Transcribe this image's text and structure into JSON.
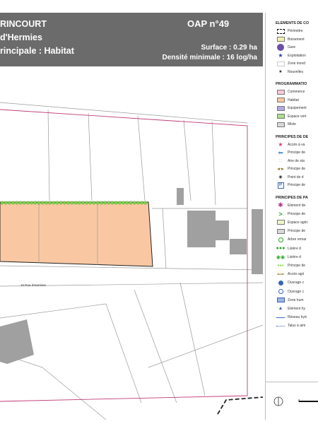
{
  "header": {
    "title_line1": "RINCOURT",
    "title_line2": "d'Hermies",
    "title_line3": "rincipale : Habitat",
    "oap": "OAP n°49",
    "surface": "Surface : 0.29 ha",
    "density": "Densité minimale : 16 log/ha"
  },
  "map": {
    "street_label": "15  Rue d'Hermies",
    "colors": {
      "habitat": "#f9c8a3",
      "green_line": "#7cd44a",
      "perimeter": "#c03a78",
      "building": "#a0a0a0"
    }
  },
  "legend": {
    "sections": [
      {
        "title": "ELEMENTS DE CO",
        "items": [
          {
            "icon": "perimeter-dashed-icon",
            "label": "Périmètre"
          },
          {
            "icon": "woodland-icon",
            "label": "Boisement"
          },
          {
            "icon": "train-station-icon",
            "label": "Gare"
          },
          {
            "icon": "star-icon",
            "label": "Exploitation"
          },
          {
            "icon": "zone-icon",
            "label": "Zone inond"
          },
          {
            "icon": "small-star-icon",
            "label": "Nouvelles"
          }
        ]
      },
      {
        "title": "PROGRAMMATIO",
        "items": [
          {
            "icon": "pink-swatch-icon",
            "label": "Commerce"
          },
          {
            "icon": "orange-swatch-icon",
            "label": "Habitat"
          },
          {
            "icon": "purple-swatch-icon",
            "label": "Equipement"
          },
          {
            "icon": "green-swatch-icon",
            "label": "Espace vert"
          },
          {
            "icon": "grey-swatch-icon",
            "label": "Mixte"
          }
        ]
      },
      {
        "title": "PRINCIPES DE DE",
        "items": [
          {
            "icon": "access-star-icon",
            "label": "Accès à va"
          },
          {
            "icon": "blue-arrow-icon",
            "label": "Principe de"
          },
          {
            "icon": "dotted-line-icon",
            "label": "Aire de sta"
          },
          {
            "icon": "double-arrow-icon",
            "label": "Principe de"
          },
          {
            "icon": "point-icon",
            "label": "Point de d"
          },
          {
            "icon": "parking-icon",
            "label": "Principe de"
          }
        ]
      },
      {
        "title": "PRINCIPES DE PA",
        "items": [
          {
            "icon": "flower-icon",
            "label": "Elément de"
          },
          {
            "icon": "chevron-icon",
            "label": "Principe de"
          },
          {
            "icon": "light-green-swatch-icon",
            "label": "Espace agric"
          },
          {
            "icon": "grey-swatch-icon",
            "label": "Principe de"
          },
          {
            "icon": "tree-icon",
            "label": "Arbre remar"
          },
          {
            "icon": "hedge-icon",
            "label": "Lisière d"
          },
          {
            "icon": "double-circle-icon",
            "label": "Lisière d"
          },
          {
            "icon": "green-dots-icon",
            "label": "Principe de"
          },
          {
            "icon": "olive-arrow-icon",
            "label": "Accès agri"
          },
          {
            "icon": "blue-circle-icon",
            "label": "Ouvrage c"
          },
          {
            "icon": "blue-ring-icon",
            "label": "Ouvrage c"
          },
          {
            "icon": "blue-rect-icon",
            "label": "Zone hum"
          },
          {
            "icon": "triangle-icon",
            "label": "Elément hy"
          },
          {
            "icon": "blue-line-icon",
            "label": "Réseau hyd"
          },
          {
            "icon": "dotted-blue-line-icon",
            "label": "Talus à aim"
          }
        ]
      }
    ]
  }
}
